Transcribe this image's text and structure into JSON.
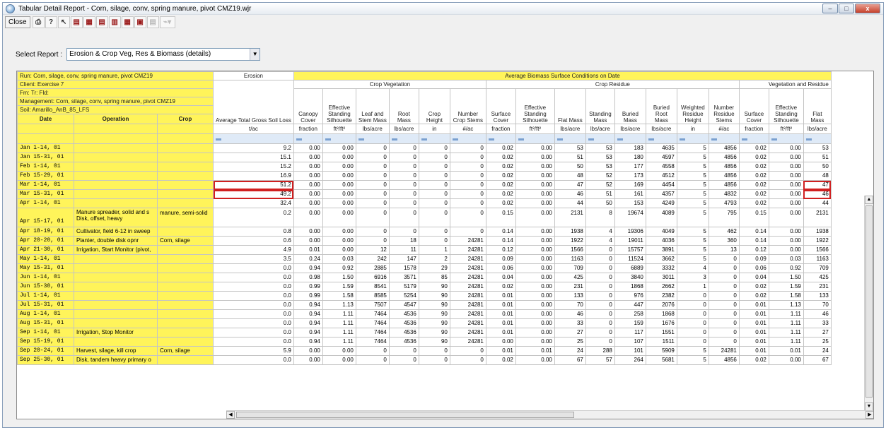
{
  "window": {
    "title": "Tabular Detail Report - Corn, silage, conv, spring manure, pivot CMZ19.wjr"
  },
  "window_buttons": {
    "minimize": "–",
    "maximize": "□",
    "close": "x"
  },
  "toolbar": {
    "close_label": "Close",
    "icons": [
      "printer-icon",
      "help-icon",
      "context-help-icon",
      "report-icon-1",
      "report-icon-2",
      "report-icon-3",
      "report-icon-4",
      "report-icon-5",
      "report-icon-6",
      "report-icon-disabled",
      "chart-dropdown-icon"
    ]
  },
  "select": {
    "label": "Select Report :",
    "value": "Erosion & Crop Veg, Res & Biomass (details)"
  },
  "info": {
    "run": "Run: Corn, silage, conv, spring manure, pivot CMZ19",
    "client": "Client: Exercise 7",
    "fm": "Fm:  Tr:  Fld:",
    "management": "Management: Corn, silage, conv, spring manure, pivot CMZ19",
    "soil": "Soil: Amarillo_AnB_85_LFS"
  },
  "groups": {
    "erosion": "Erosion",
    "avg_biomass": "Average Biomass Surface Conditions on Date",
    "crop_vegetation": "Crop Vegetation",
    "crop_residue": "Crop Residue",
    "veg_and_residue": "Vegetation and Residue"
  },
  "columns": {
    "date": "Date",
    "operation": "Operation",
    "crop": "Crop",
    "heads": [
      "Average Total Gross Soil Loss",
      "Canopy Cover",
      "Effective Standing Silhouette",
      "Leaf and Stem Mass",
      "Root Mass",
      "Crop Height",
      "Number Crop Stems",
      "Surface Cover",
      "Effective Standing Silhouette",
      "Flat Mass",
      "Standing Mass",
      "Buried Mass",
      "Buried Root Mass",
      "Weighted Residue Height",
      "Number Residue Stems",
      "Surface Cover",
      "Effective Standing Silhouette",
      "Flat Mass"
    ],
    "units": [
      "t/ac",
      "fraction",
      "ft²/ft²",
      "lbs/acre",
      "lbs/acre",
      "in",
      "#/ac",
      "fraction",
      "ft²/ft²",
      "lbs/acre",
      "lbs/acre",
      "lbs/acre",
      "lbs/acre",
      "in",
      "#/ac",
      "fraction",
      "ft²/ft²",
      "lbs/acre"
    ]
  },
  "rows": [
    {
      "date": "Jan  1-14, 01",
      "op": "",
      "crop": "",
      "v": [
        "9.2",
        "0.00",
        "0.00",
        "0",
        "0",
        "0",
        "0",
        "0.02",
        "0.00",
        "53",
        "53",
        "183",
        "4635",
        "5",
        "4856",
        "0.02",
        "0.00",
        "53"
      ]
    },
    {
      "date": "Jan 15-31, 01",
      "op": "",
      "crop": "",
      "v": [
        "15.1",
        "0.00",
        "0.00",
        "0",
        "0",
        "0",
        "0",
        "0.02",
        "0.00",
        "51",
        "53",
        "180",
        "4597",
        "5",
        "4856",
        "0.02",
        "0.00",
        "51"
      ]
    },
    {
      "date": "Feb  1-14, 01",
      "op": "",
      "crop": "",
      "v": [
        "15.2",
        "0.00",
        "0.00",
        "0",
        "0",
        "0",
        "0",
        "0.02",
        "0.00",
        "50",
        "53",
        "177",
        "4558",
        "5",
        "4856",
        "0.02",
        "0.00",
        "50"
      ]
    },
    {
      "date": "Feb 15-29, 01",
      "op": "",
      "crop": "",
      "v": [
        "16.9",
        "0.00",
        "0.00",
        "0",
        "0",
        "0",
        "0",
        "0.02",
        "0.00",
        "48",
        "52",
        "173",
        "4512",
        "5",
        "4856",
        "0.02",
        "0.00",
        "48"
      ]
    },
    {
      "date": "Mar  1-14, 01",
      "op": "",
      "crop": "",
      "v": [
        "51.2",
        "0.00",
        "0.00",
        "0",
        "0",
        "0",
        "0",
        "0.02",
        "0.00",
        "47",
        "52",
        "169",
        "4454",
        "5",
        "4856",
        "0.02",
        "0.00",
        "47"
      ]
    },
    {
      "date": "Mar 15-31, 01",
      "op": "",
      "crop": "",
      "v": [
        "49.2",
        "0.00",
        "0.00",
        "0",
        "0",
        "0",
        "0",
        "0.02",
        "0.00",
        "46",
        "51",
        "161",
        "4357",
        "5",
        "4832",
        "0.02",
        "0.00",
        "46"
      ]
    },
    {
      "date": "Apr  1-14, 01",
      "op": "",
      "crop": "",
      "v": [
        "32.4",
        "0.00",
        "0.00",
        "0",
        "0",
        "0",
        "0",
        "0.02",
        "0.00",
        "44",
        "50",
        "153",
        "4249",
        "5",
        "4793",
        "0.02",
        "0.00",
        "44"
      ]
    },
    {
      "date": "Apr 15-17, 01",
      "op": "Manure spreader, solid and s\nDisk, offset, heavy",
      "crop": "manure, semi-solid",
      "v": [
        "0.2",
        "0.00",
        "0.00",
        "0",
        "0",
        "0",
        "0",
        "0.15",
        "0.00",
        "2131",
        "8",
        "19674",
        "4089",
        "5",
        "795",
        "0.15",
        "0.00",
        "2131"
      ]
    },
    {
      "date": "Apr 18-19, 01",
      "op": "Cultivator, field 6-12 in sweep",
      "crop": "",
      "v": [
        "0.8",
        "0.00",
        "0.00",
        "0",
        "0",
        "0",
        "0",
        "0.14",
        "0.00",
        "1938",
        "4",
        "19306",
        "4049",
        "5",
        "462",
        "0.14",
        "0.00",
        "1938"
      ]
    },
    {
      "date": "Apr 20-20, 01",
      "op": "Planter, double disk opnr",
      "crop": "Corn, silage",
      "v": [
        "0.6",
        "0.00",
        "0.00",
        "0",
        "18",
        "0",
        "24281",
        "0.14",
        "0.00",
        "1922",
        "4",
        "19011",
        "4036",
        "5",
        "360",
        "0.14",
        "0.00",
        "1922"
      ]
    },
    {
      "date": "Apr 21-30, 01",
      "op": "Irrigation, Start Monitor (pivot,",
      "crop": "",
      "v": [
        "4.9",
        "0.01",
        "0.00",
        "12",
        "11",
        "1",
        "24281",
        "0.12",
        "0.00",
        "1566",
        "0",
        "15757",
        "3891",
        "5",
        "13",
        "0.12",
        "0.00",
        "1566"
      ]
    },
    {
      "date": "May  1-14, 01",
      "op": "",
      "crop": "",
      "v": [
        "3.5",
        "0.24",
        "0.03",
        "242",
        "147",
        "2",
        "24281",
        "0.09",
        "0.00",
        "1163",
        "0",
        "11524",
        "3662",
        "5",
        "0",
        "0.09",
        "0.03",
        "1163"
      ]
    },
    {
      "date": "May 15-31, 01",
      "op": "",
      "crop": "",
      "v": [
        "0.0",
        "0.94",
        "0.92",
        "2885",
        "1578",
        "29",
        "24281",
        "0.06",
        "0.00",
        "709",
        "0",
        "6889",
        "3332",
        "4",
        "0",
        "0.06",
        "0.92",
        "709"
      ]
    },
    {
      "date": "Jun  1-14, 01",
      "op": "",
      "crop": "",
      "v": [
        "0.0",
        "0.98",
        "1.50",
        "6916",
        "3571",
        "85",
        "24281",
        "0.04",
        "0.00",
        "425",
        "0",
        "3840",
        "3011",
        "3",
        "0",
        "0.04",
        "1.50",
        "425"
      ]
    },
    {
      "date": "Jun 15-30, 01",
      "op": "",
      "crop": "",
      "v": [
        "0.0",
        "0.99",
        "1.59",
        "8541",
        "5179",
        "90",
        "24281",
        "0.02",
        "0.00",
        "231",
        "0",
        "1868",
        "2662",
        "1",
        "0",
        "0.02",
        "1.59",
        "231"
      ]
    },
    {
      "date": "Jul  1-14, 01",
      "op": "",
      "crop": "",
      "v": [
        "0.0",
        "0.99",
        "1.58",
        "8585",
        "5254",
        "90",
        "24281",
        "0.01",
        "0.00",
        "133",
        "0",
        "976",
        "2382",
        "0",
        "0",
        "0.02",
        "1.58",
        "133"
      ]
    },
    {
      "date": "Jul 15-31, 01",
      "op": "",
      "crop": "",
      "v": [
        "0.0",
        "0.94",
        "1.13",
        "7507",
        "4547",
        "90",
        "24281",
        "0.01",
        "0.00",
        "70",
        "0",
        "447",
        "2076",
        "0",
        "0",
        "0.01",
        "1.13",
        "70"
      ]
    },
    {
      "date": "Aug  1-14, 01",
      "op": "",
      "crop": "",
      "v": [
        "0.0",
        "0.94",
        "1.11",
        "7464",
        "4536",
        "90",
        "24281",
        "0.01",
        "0.00",
        "46",
        "0",
        "258",
        "1868",
        "0",
        "0",
        "0.01",
        "1.11",
        "46"
      ]
    },
    {
      "date": "Aug 15-31, 01",
      "op": "",
      "crop": "",
      "v": [
        "0.0",
        "0.94",
        "1.11",
        "7464",
        "4536",
        "90",
        "24281",
        "0.01",
        "0.00",
        "33",
        "0",
        "159",
        "1676",
        "0",
        "0",
        "0.01",
        "1.11",
        "33"
      ]
    },
    {
      "date": "Sep  1-14, 01",
      "op": "Irrigation, Stop Monitor",
      "crop": "",
      "v": [
        "0.0",
        "0.94",
        "1.11",
        "7464",
        "4536",
        "90",
        "24281",
        "0.01",
        "0.00",
        "27",
        "0",
        "117",
        "1551",
        "0",
        "0",
        "0.01",
        "1.11",
        "27"
      ]
    },
    {
      "date": "Sep 15-19, 01",
      "op": "",
      "crop": "",
      "v": [
        "0.0",
        "0.94",
        "1.11",
        "7464",
        "4536",
        "90",
        "24281",
        "0.00",
        "0.00",
        "25",
        "0",
        "107",
        "1511",
        "0",
        "0",
        "0.01",
        "1.11",
        "25"
      ]
    },
    {
      "date": "Sep 20-24, 01",
      "op": "Harvest, silage, kill crop",
      "crop": "Corn, silage",
      "v": [
        "5.9",
        "0.00",
        "0.00",
        "0",
        "0",
        "0",
        "0",
        "0.01",
        "0.01",
        "24",
        "288",
        "101",
        "5909",
        "5",
        "24281",
        "0.01",
        "0.01",
        "24"
      ]
    },
    {
      "date": "Sep 25-30, 01",
      "op": "Disk, tandem heavy primary o",
      "crop": "",
      "v": [
        "0.0",
        "0.00",
        "0.00",
        "0",
        "0",
        "0",
        "0",
        "0.02",
        "0.00",
        "67",
        "57",
        "264",
        "5681",
        "5",
        "4856",
        "0.02",
        "0.00",
        "67"
      ]
    }
  ],
  "highlighted": [
    {
      "row": 4,
      "col": 0
    },
    {
      "row": 5,
      "col": 0
    },
    {
      "row": 4,
      "col": 17
    },
    {
      "row": 5,
      "col": 17
    }
  ]
}
